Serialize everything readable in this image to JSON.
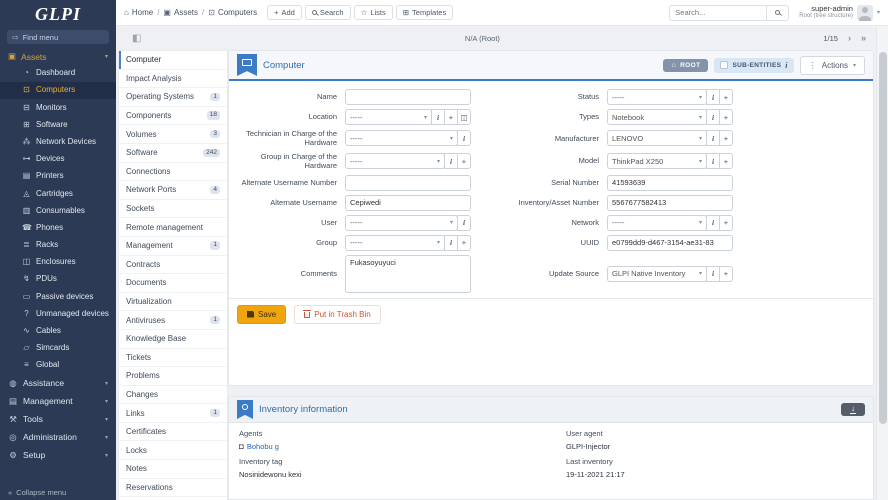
{
  "app": {
    "logo_text": "GLPI"
  },
  "colors": {
    "sidebar_bg": "#2c3a55",
    "gold": "#d6a338",
    "gold_bright": "#e9b235",
    "blue": "#3c7cc6",
    "blue_text": "#2d6fb0",
    "save_yellow": "#f0a40e",
    "danger": "#cf5330"
  },
  "topbar": {
    "breadcrumb": [
      {
        "icon": "home-icon",
        "label": "Home"
      },
      {
        "icon": "assets-icon",
        "label": "Assets"
      },
      {
        "icon": "computer-icon",
        "label": "Computers"
      }
    ],
    "buttons": [
      {
        "icon": "plus-icon",
        "label": "Add"
      },
      {
        "icon": "search-icon",
        "label": "Search"
      },
      {
        "icon": "star-icon",
        "label": "Lists"
      },
      {
        "icon": "grid-icon",
        "label": "Templates"
      }
    ],
    "search_placeholder": "Search...",
    "user_name": "super-admin",
    "user_context": "Root (tree structure)"
  },
  "subbar": {
    "entity": "N/A (Root)",
    "pagination": "1/15"
  },
  "sidebar": {
    "find_menu": "Find menu",
    "assets_section": "Assets",
    "asset_items": [
      {
        "icon": "dashboard-icon",
        "label": "Dashboard"
      },
      {
        "icon": "computers-icon",
        "label": "Computers",
        "active": true
      },
      {
        "icon": "monitors-icon",
        "label": "Monitors"
      },
      {
        "icon": "software-icon",
        "label": "Software"
      },
      {
        "icon": "network-devices-icon",
        "label": "Network Devices"
      },
      {
        "icon": "devices-icon",
        "label": "Devices"
      },
      {
        "icon": "printers-icon",
        "label": "Printers"
      },
      {
        "icon": "cartridges-icon",
        "label": "Cartridges"
      },
      {
        "icon": "consumables-icon",
        "label": "Consumables"
      },
      {
        "icon": "phones-icon",
        "label": "Phones"
      },
      {
        "icon": "racks-icon",
        "label": "Racks"
      },
      {
        "icon": "enclosures-icon",
        "label": "Enclosures"
      },
      {
        "icon": "pdus-icon",
        "label": "PDUs"
      },
      {
        "icon": "passive-devices-icon",
        "label": "Passive devices"
      },
      {
        "icon": "unmanaged-devices-icon",
        "label": "Unmanaged devices"
      },
      {
        "icon": "cables-icon",
        "label": "Cables"
      },
      {
        "icon": "simcards-icon",
        "label": "Simcards"
      },
      {
        "icon": "global-icon",
        "label": "Global"
      }
    ],
    "bottom_sections": [
      {
        "icon": "assistance-icon",
        "label": "Assistance"
      },
      {
        "icon": "management-icon",
        "label": "Management"
      },
      {
        "icon": "tools-icon",
        "label": "Tools"
      },
      {
        "icon": "administration-icon",
        "label": "Administration"
      },
      {
        "icon": "setup-icon",
        "label": "Setup"
      }
    ],
    "collapse_label": "Collapse menu"
  },
  "tabs": [
    {
      "label": "Computer",
      "active": true
    },
    {
      "label": "Impact Analysis"
    },
    {
      "label": "Operating Systems",
      "badge": "1"
    },
    {
      "label": "Components",
      "badge": "18"
    },
    {
      "label": "Volumes",
      "badge": "3"
    },
    {
      "label": "Software",
      "badge": "242"
    },
    {
      "label": "Connections"
    },
    {
      "label": "Network Ports",
      "badge": "4"
    },
    {
      "label": "Sockets"
    },
    {
      "label": "Remote management"
    },
    {
      "label": "Management",
      "badge": "1"
    },
    {
      "label": "Contracts"
    },
    {
      "label": "Documents"
    },
    {
      "label": "Virtualization"
    },
    {
      "label": "Antiviruses",
      "badge": "1"
    },
    {
      "label": "Knowledge Base"
    },
    {
      "label": "Tickets"
    },
    {
      "label": "Problems"
    },
    {
      "label": "Changes"
    },
    {
      "label": "Links",
      "badge": "1"
    },
    {
      "label": "Certificates"
    },
    {
      "label": "Locks"
    },
    {
      "label": "Notes"
    },
    {
      "label": "Reservations"
    }
  ],
  "form": {
    "title": "Computer",
    "root_badge": "ROOT",
    "sub_entities_label": "SUB-ENTITIES",
    "actions_label": "Actions",
    "left_fields": [
      {
        "label": "Name",
        "type": "text",
        "value": ""
      },
      {
        "label": "Location",
        "type": "select",
        "value": "-----",
        "buttons": [
          "i",
          "plus",
          "map"
        ]
      },
      {
        "label": "Technician in Charge of the Hardware",
        "type": "select",
        "value": "-----",
        "buttons": [
          "i"
        ]
      },
      {
        "label": "Group in Charge of the Hardware",
        "type": "select",
        "value": "-----",
        "buttons": [
          "i",
          "plus"
        ]
      },
      {
        "label": "Alternate Username Number",
        "type": "text",
        "value": ""
      },
      {
        "label": "Alternate Username",
        "type": "text",
        "value": "Cepiwedi"
      },
      {
        "label": "User",
        "type": "select",
        "value": "-----",
        "buttons": [
          "i"
        ]
      },
      {
        "label": "Group",
        "type": "select",
        "value": "-----",
        "buttons": [
          "i",
          "plus"
        ]
      },
      {
        "label": "Comments",
        "type": "textarea",
        "value": "Fukasoyuyuci"
      }
    ],
    "right_fields": [
      {
        "label": "Status",
        "type": "select",
        "value": "-----",
        "buttons": [
          "i",
          "plus"
        ]
      },
      {
        "label": "Types",
        "type": "select",
        "value": "Notebook",
        "buttons": [
          "i",
          "plus"
        ]
      },
      {
        "label": "Manufacturer",
        "type": "select",
        "value": "LENOVO",
        "buttons": [
          "i",
          "plus"
        ]
      },
      {
        "label": "Model",
        "type": "select",
        "value": "ThinkPad X250",
        "buttons": [
          "i",
          "plus"
        ]
      },
      {
        "label": "Serial Number",
        "type": "text",
        "value": "41593639"
      },
      {
        "label": "Inventory/Asset Number",
        "type": "text",
        "value": "5567677582413"
      },
      {
        "label": "Network",
        "type": "select",
        "value": "-----",
        "buttons": [
          "i",
          "plus"
        ]
      },
      {
        "label": "UUID",
        "type": "text",
        "value": "e0799dd9-d467-3154-ae31-83"
      },
      {
        "label": "Update Source",
        "type": "select",
        "value": "GLPI Native Inventory",
        "buttons": [
          "i",
          "plus"
        ]
      }
    ],
    "save_label": "Save",
    "trash_label": "Put in Trash Bin"
  },
  "inventory": {
    "title": "Inventory information",
    "fields_left": [
      {
        "label": "Agents",
        "value": "Bohobu g",
        "link": true,
        "icon": "robot-icon"
      },
      {
        "label": "Inventory tag",
        "value": "Nosinidewonu kexi"
      }
    ],
    "fields_right": [
      {
        "label": "User agent",
        "value": "GLPI-Injector"
      },
      {
        "label": "Last inventory",
        "value": "19-11-2021 21:17"
      }
    ]
  }
}
